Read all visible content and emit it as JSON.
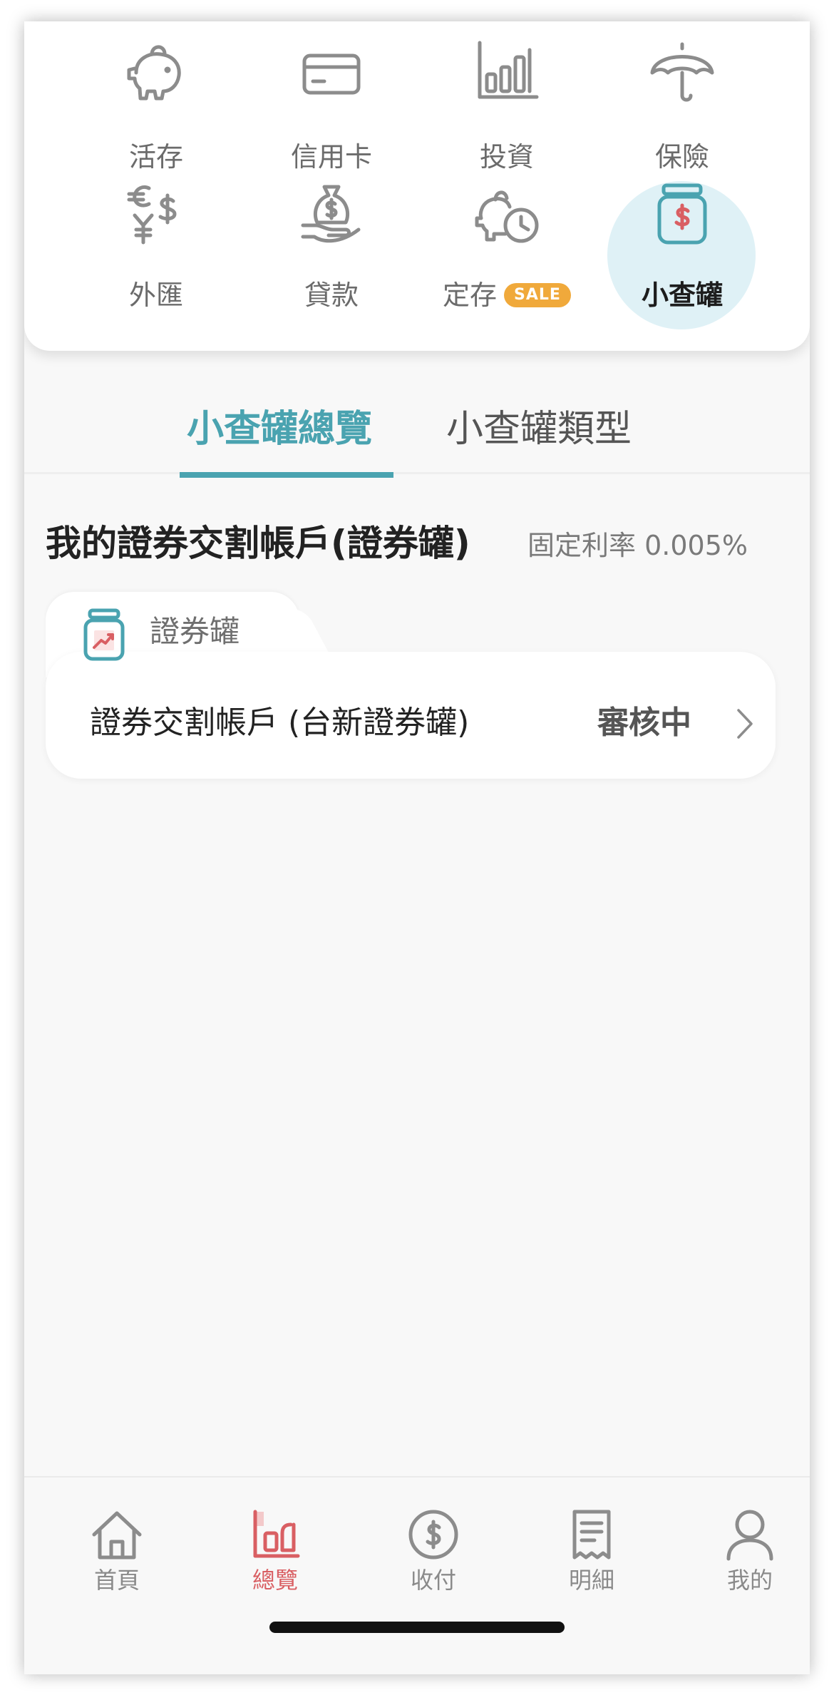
{
  "categories": [
    {
      "label": "活存",
      "icon": "piggy-bank-icon"
    },
    {
      "label": "信用卡",
      "icon": "credit-card-icon"
    },
    {
      "label": "投資",
      "icon": "bar-chart-icon"
    },
    {
      "label": "保險",
      "icon": "umbrella-icon"
    },
    {
      "label": "外匯",
      "icon": "currency-exchange-icon"
    },
    {
      "label": "貸款",
      "icon": "money-bag-hand-icon"
    },
    {
      "label": "定存",
      "icon": "piggy-clock-icon",
      "badge": "SALE"
    },
    {
      "label": "小查罐",
      "icon": "dollar-jar-icon",
      "active": true
    }
  ],
  "tabs": {
    "overview": "小查罐總覽",
    "types": "小查罐類型"
  },
  "section": {
    "title": "我的證券交割帳戶(證券罐)",
    "rate": "固定利率 0.005%"
  },
  "account": {
    "category": "證券罐",
    "name": "證券交割帳戶 (台新證券罐)",
    "status": "審核中"
  },
  "bottom_nav": [
    {
      "label": "首頁",
      "icon": "home-icon"
    },
    {
      "label": "總覽",
      "icon": "overview-icon",
      "active": true
    },
    {
      "label": "收付",
      "icon": "dollar-circle-icon"
    },
    {
      "label": "明細",
      "icon": "receipt-icon"
    },
    {
      "label": "我的",
      "icon": "user-icon"
    }
  ],
  "colors": {
    "accent": "#4aa3b0",
    "active_nav": "#d95f63",
    "sale": "#f0a93b",
    "icon_gray": "#8c8c8c"
  }
}
